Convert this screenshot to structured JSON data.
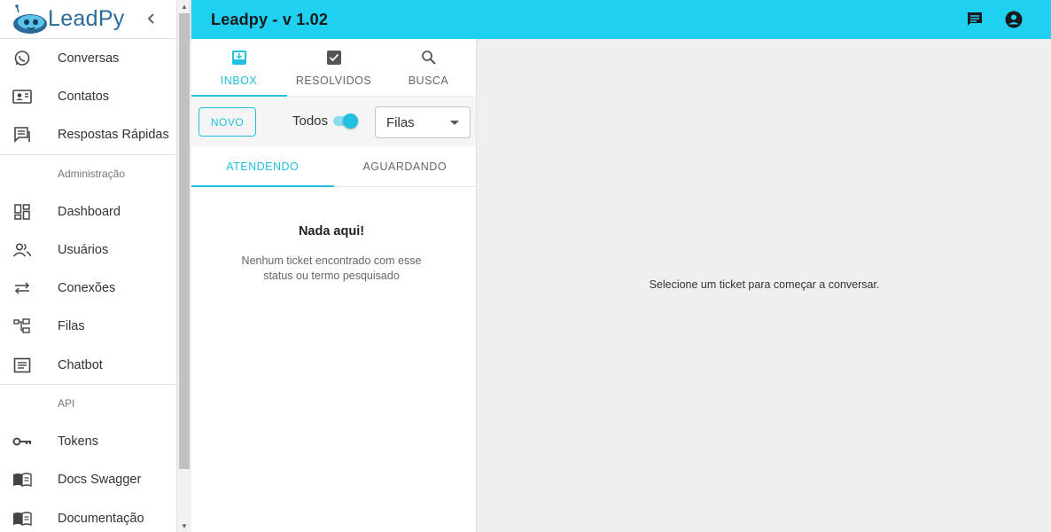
{
  "brand": {
    "name": "LeadPy"
  },
  "sidebar": {
    "items_top": [
      {
        "label": "Conversas",
        "icon": "whatsapp-icon"
      },
      {
        "label": "Contatos",
        "icon": "contact-card-icon"
      },
      {
        "label": "Respostas Rápidas",
        "icon": "quick-reply-icon"
      }
    ],
    "section_admin": "Administração",
    "items_admin": [
      {
        "label": "Dashboard",
        "icon": "dashboard-icon"
      },
      {
        "label": "Usuários",
        "icon": "users-icon"
      },
      {
        "label": "Conexões",
        "icon": "connections-icon"
      },
      {
        "label": "Filas",
        "icon": "queues-icon"
      },
      {
        "label": "Chatbot",
        "icon": "chatbot-icon"
      }
    ],
    "section_api": "API",
    "items_api": [
      {
        "label": "Tokens",
        "icon": "key-icon"
      },
      {
        "label": "Docs Swagger",
        "icon": "book-icon"
      },
      {
        "label": "Documentação",
        "icon": "book-icon"
      }
    ]
  },
  "topbar": {
    "title": "Leadpy - v 1.02",
    "color": "#1fd0f0"
  },
  "tabs": [
    {
      "label": "INBOX",
      "icon": "inbox-icon",
      "active": true
    },
    {
      "label": "RESOLVIDOS",
      "icon": "check-box-icon",
      "active": false
    },
    {
      "label": "BUSCA",
      "icon": "search-icon",
      "active": false
    }
  ],
  "toolbar": {
    "new_label": "NOVO",
    "toggle_label": "Todos",
    "toggle_on": true,
    "queue_select": "Filas"
  },
  "subtabs": [
    {
      "label": "ATENDENDO",
      "active": true
    },
    {
      "label": "AGUARDANDO",
      "active": false
    }
  ],
  "empty": {
    "title": "Nada aqui!",
    "subtitle": "Nenhum ticket encontrado com esse status ou termo pesquisado"
  },
  "main": {
    "message": "Selecione um ticket para começar a conversar."
  },
  "accent": "#1fc0e0"
}
